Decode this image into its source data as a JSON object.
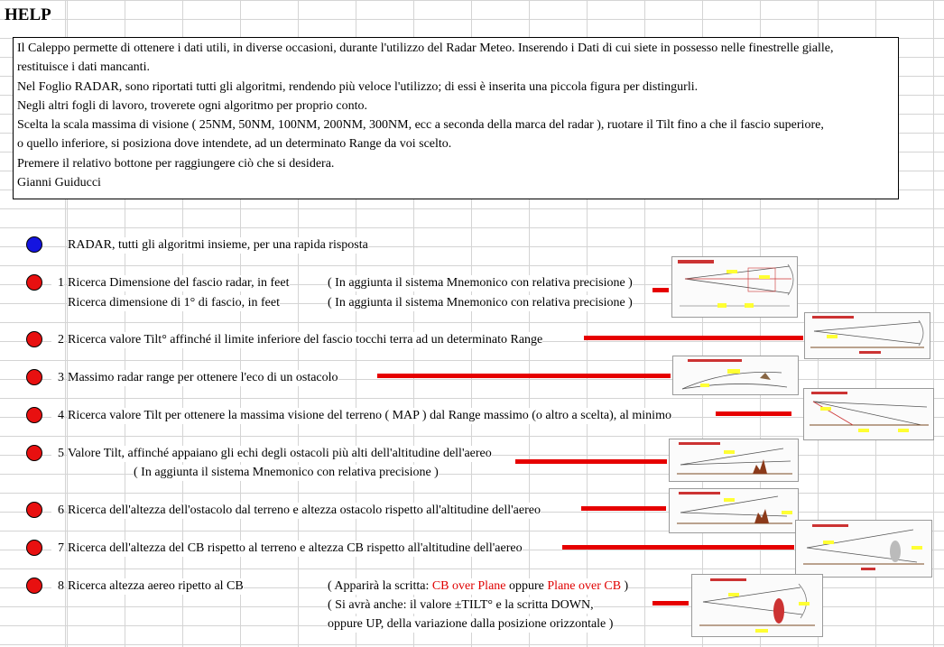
{
  "sheet_title": "HELP",
  "help_lines": [
    "Il Caleppo permette di ottenere i dati utili, in diverse occasioni, durante l'utilizzo del Radar Meteo. Inserendo i Dati di cui siete in possesso nelle finestrelle gialle,",
    "restituisce i dati mancanti.",
    "Nel Foglio RADAR, sono riportati tutti gli algoritmi, rendendo più veloce l'utilizzo; di essi è inserita una piccola figura per distingurli.",
    "Negli altri fogli di lavoro, troverete ogni algoritmo per proprio conto.",
    "Scelta la scala massima di visione ( 25NM, 50NM, 100NM, 200NM, 300NM, ecc a seconda della marca del radar ), ruotare il Tilt fino a che il fascio superiore,",
    "o quello inferiore, si posiziona dove intendete, ad un determinato Range da voi scelto.",
    "Premere il relativo bottone per raggiungere ciò che si desidera.",
    "Gianni Guiducci"
  ],
  "colors": {
    "blue_button": "#1414e0",
    "red_button": "#e81010",
    "connector": "#e60000"
  },
  "items": {
    "radar": {
      "label": "RADAR, tutti gli algoritmi insieme, per una rapida risposta"
    },
    "i1": {
      "num": "1",
      "label": "Ricerca Dimensione del fascio radar, in feet",
      "note": "( In aggiunta il sistema Mnemonico con relativa precisione )",
      "label2": "Ricerca dimensione di 1° di fascio, in feet",
      "note2": "( In aggiunta il sistema Mnemonico con relativa precisione )"
    },
    "i2": {
      "num": "2",
      "label": "Ricerca valore Tilt° affinché il limite inferiore del fascio tocchi terra ad un determinato Range"
    },
    "i3": {
      "num": "3",
      "label": "Massimo radar range per ottenere l'eco di un ostacolo"
    },
    "i4": {
      "num": "4",
      "label": "Ricerca valore Tilt per ottenere la massima visione del terreno ( MAP ) dal Range massimo (o altro a scelta), al minimo"
    },
    "i5": {
      "num": "5",
      "label": "Valore Tilt, affinché appaiano gli echi degli ostacoli più alti dell'altitudine dell'aereo",
      "note": "( In aggiunta il sistema Mnemonico con relativa precisione )"
    },
    "i6": {
      "num": "6",
      "label": "Ricerca dell'altezza dell'ostacolo dal terreno e altezza ostacolo rispetto all'altitudine dell'aereo"
    },
    "i7": {
      "num": "7",
      "label": "Ricerca dell'altezza del CB rispetto al terreno e altezza CB rispetto all'altitudine dell'aereo"
    },
    "i8": {
      "num": "8",
      "label": "Ricerca altezza aereo ripetto al CB",
      "note_a_pre": "( Apparirà la scritta: ",
      "note_a_red1": "CB over Plane",
      "note_a_mid": " oppure ",
      "note_a_red2": "Plane over CB",
      "note_a_post": " )",
      "note_b": "( Si avrà anche: il valore ±TILT° e la scritta DOWN,",
      "note_c": "oppure UP, della variazione dalla posizione orizzontale )"
    }
  }
}
